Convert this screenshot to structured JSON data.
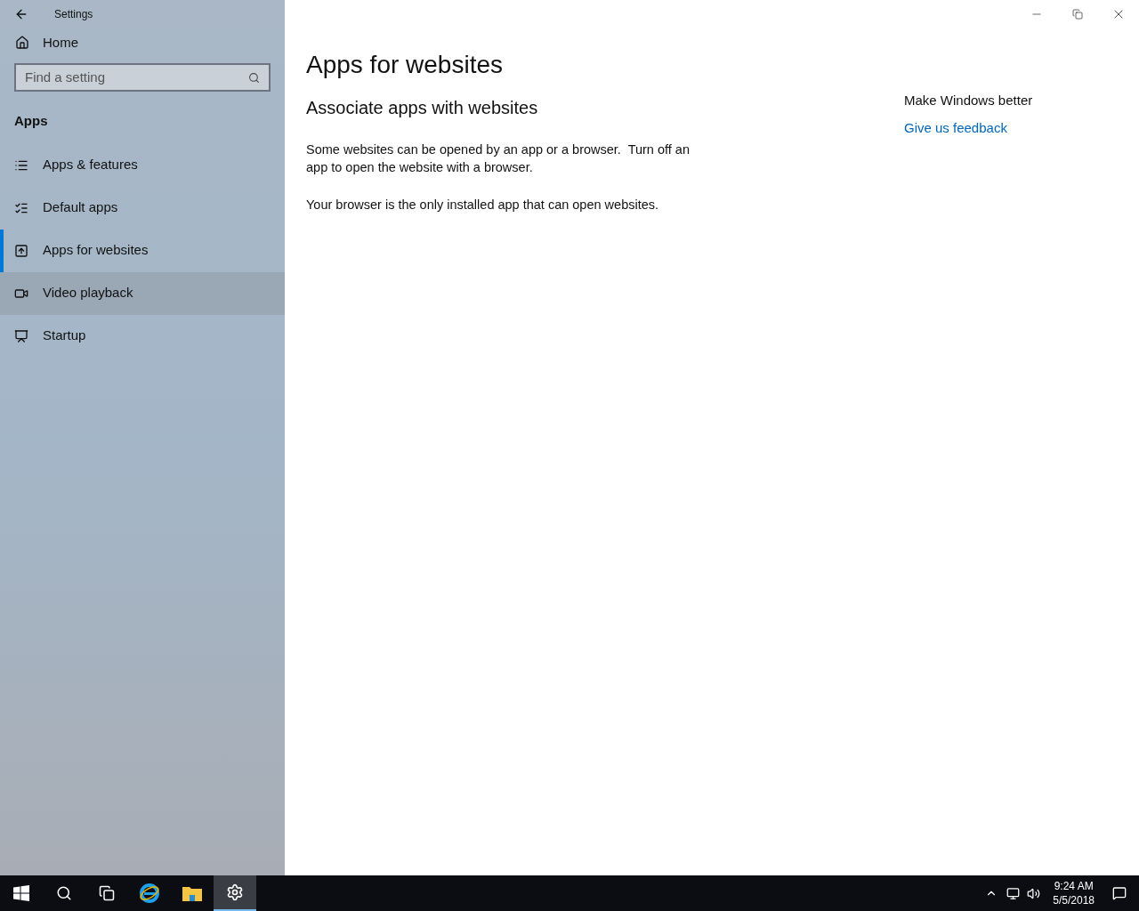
{
  "window": {
    "title": "Settings"
  },
  "sidebar": {
    "home": "Home",
    "search": {
      "placeholder": "Find a setting"
    },
    "section": "Apps",
    "items": [
      {
        "label": "Apps & features",
        "kind": "list",
        "selected": false,
        "hovered": false
      },
      {
        "label": "Default apps",
        "kind": "defaults",
        "selected": false,
        "hovered": false
      },
      {
        "label": "Apps for websites",
        "kind": "web",
        "selected": true,
        "hovered": false
      },
      {
        "label": "Video playback",
        "kind": "video",
        "selected": false,
        "hovered": true
      },
      {
        "label": "Startup",
        "kind": "startup",
        "selected": false,
        "hovered": false
      }
    ]
  },
  "main": {
    "title": "Apps for websites",
    "subtitle": "Associate apps with websites",
    "paragraphs": [
      "Some websites can be opened by an app or a browser.  Turn off an app to open the website with a browser.",
      "Your browser is the only installed app that can open websites."
    ]
  },
  "aside": {
    "heading": "Make Windows better",
    "link": "Give us feedback"
  },
  "taskbar": {
    "apps": [
      {
        "kind": "start",
        "active": false
      },
      {
        "kind": "search",
        "active": false
      },
      {
        "kind": "taskview",
        "active": false
      },
      {
        "kind": "ie",
        "active": false
      },
      {
        "kind": "explorer",
        "active": false
      },
      {
        "kind": "settings",
        "active": true
      }
    ],
    "time": "9:24 AM",
    "date": "5/5/2018"
  }
}
